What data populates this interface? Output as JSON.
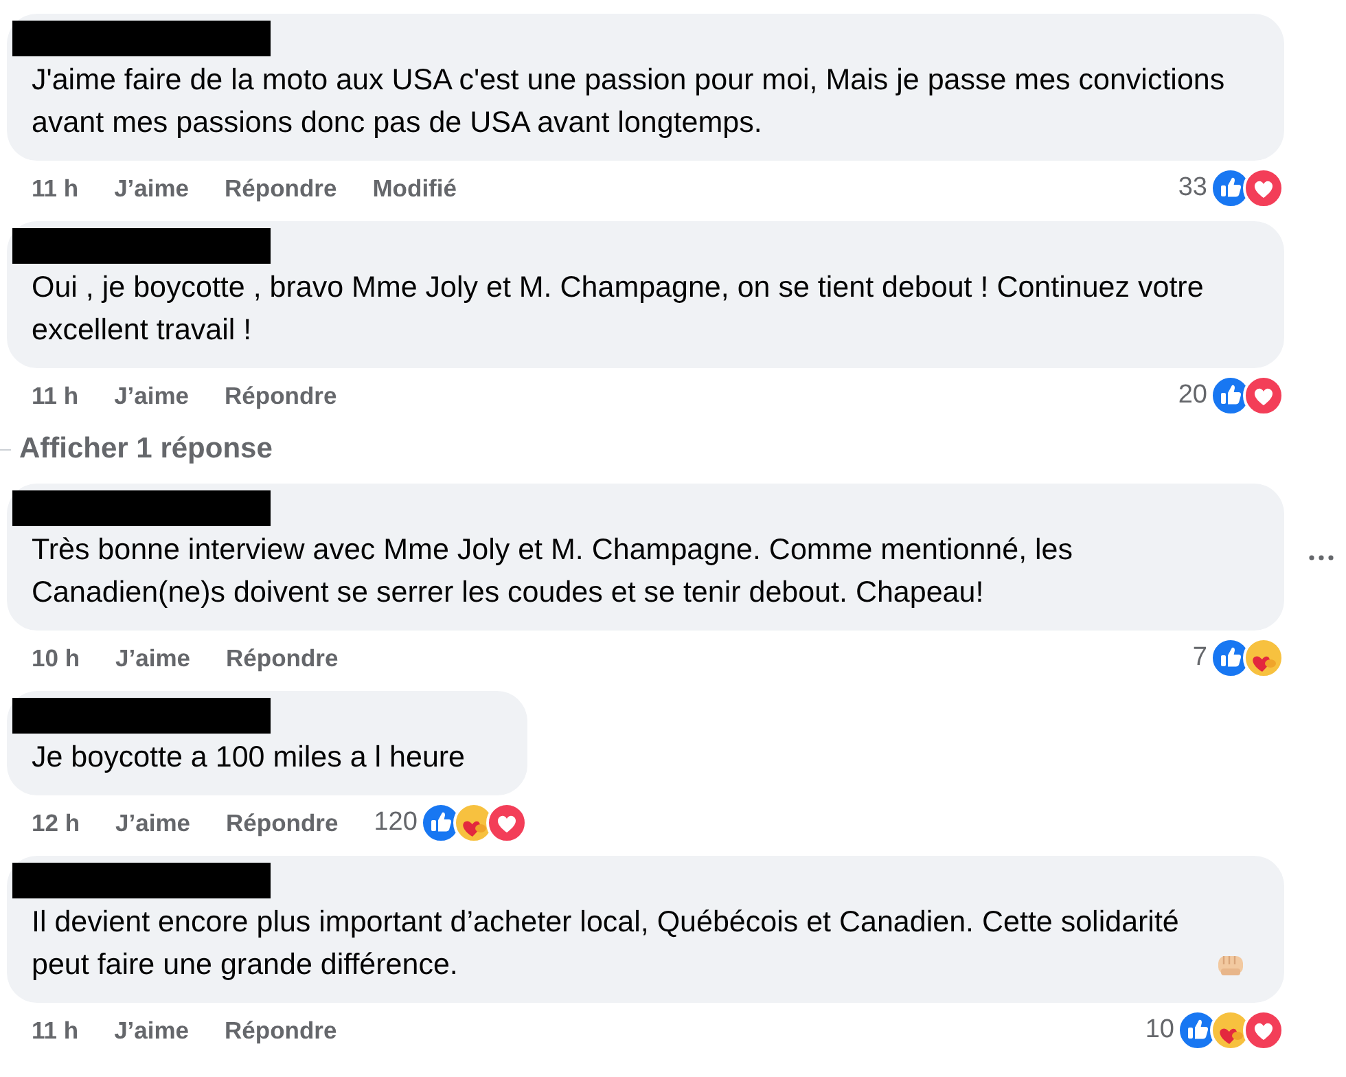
{
  "items": [
    {
      "kind": "comment",
      "author_redacted": true,
      "text": "J'aime faire de la moto aux USA c'est une passion pour moi, Mais je passe mes convictions avant mes passions donc pas de USA avant longtemps.",
      "time": "11 h",
      "like_label": "J’aime",
      "reply_label": "Répondre",
      "edited_label": "Modifié",
      "reaction_count": "33",
      "reactions": [
        {
          "kind": "like"
        },
        {
          "kind": "love"
        }
      ]
    },
    {
      "kind": "comment",
      "author_redacted": true,
      "text": "Oui , je boycotte , bravo Mme Joly et M. Champagne, on se tient debout ! Continuez votre excellent travail !",
      "time": "11 h",
      "like_label": "J’aime",
      "reply_label": "Répondre",
      "reaction_count": "20",
      "reactions": [
        {
          "kind": "like"
        },
        {
          "kind": "love"
        }
      ]
    },
    {
      "kind": "replies_link",
      "label": "Afficher 1 réponse"
    },
    {
      "kind": "comment",
      "author_redacted": true,
      "text": "Très bonne interview avec Mme Joly et M. Champagne. Comme mentionné, les Canadien(ne)s doivent se serrer les coudes et se tenir debout. Chapeau!",
      "time": "10 h",
      "like_label": "J’aime",
      "reply_label": "Répondre",
      "reaction_count": "7",
      "reactions": [
        {
          "kind": "like"
        },
        {
          "kind": "care"
        }
      ],
      "more_button": true
    },
    {
      "kind": "comment",
      "author_redacted": true,
      "text": "Je boycotte a 100 miles a l heure",
      "time": "12 h",
      "like_label": "J’aime",
      "reply_label": "Répondre",
      "reaction_count": "120",
      "reactions": [
        {
          "kind": "like"
        },
        {
          "kind": "care"
        },
        {
          "kind": "love"
        }
      ]
    },
    {
      "kind": "comment",
      "author_redacted": true,
      "text": "Il devient encore plus important d’acheter local, Québécois et Canadien. Cette solidarité peut faire une grande différence.",
      "trailing_icon": {
        "kind": "fist"
      },
      "time": "11 h",
      "like_label": "J’aime",
      "reply_label": "Répondre",
      "reaction_count": "10",
      "reactions": [
        {
          "kind": "like"
        },
        {
          "kind": "care"
        },
        {
          "kind": "love"
        }
      ]
    }
  ]
}
